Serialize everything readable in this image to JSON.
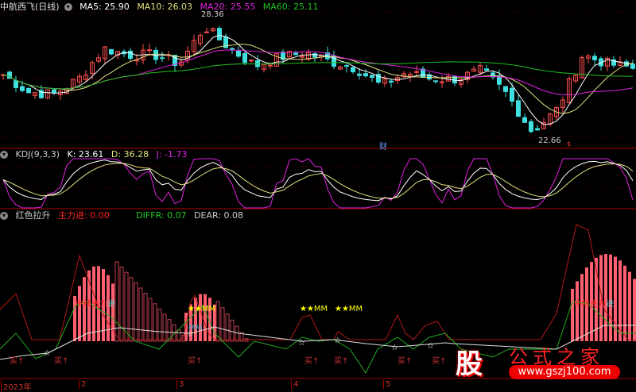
{
  "stock": {
    "title": "中航西飞(日线)",
    "ma5": "MA5: 25.90",
    "ma10": "MA10: 26.03",
    "ma20": "MA20: 25.55",
    "ma60": "MA60: 25.11",
    "high": "28.36",
    "low": "22.66",
    "cai": "财",
    "mark": "$"
  },
  "kdj": {
    "title": "KDJ(9,3,3)",
    "k": "K: 23.61",
    "d": "D: 36.28",
    "j": "J: -1.73"
  },
  "ind": {
    "title": "红色拉升",
    "zl": "主力进: 0.00",
    "diffr": "DIFFR: 0.07",
    "dear": "DEAR: 0.08",
    "sig1": "中线主力",
    "sig1b": "进",
    "stars": "★★MM",
    "mm": "MM",
    "buy": "买↑"
  },
  "axis": [
    "2023年",
    "2",
    "3",
    "4",
    "5"
  ],
  "logo": {
    "char": "股",
    "name": "公式之家",
    "url": "www.gszj100.com"
  },
  "colors": {
    "up": "#ff5050",
    "down": "#40e0e0",
    "ma5": "#ffffff",
    "ma10": "#e0e080",
    "ma20": "#e020e0",
    "ma60": "#20c020"
  },
  "price_keypoints": [
    25.6,
    24.8,
    24.7,
    25.4,
    26.8,
    26.5,
    26.5,
    26.1,
    27.8,
    26.8,
    26.0,
    26.4,
    26.6,
    26.2,
    25.9,
    25.1,
    25.7,
    25.4,
    25.4,
    25.8,
    24.7,
    23.0,
    24.0,
    26.5,
    26.1,
    25.9
  ]
}
